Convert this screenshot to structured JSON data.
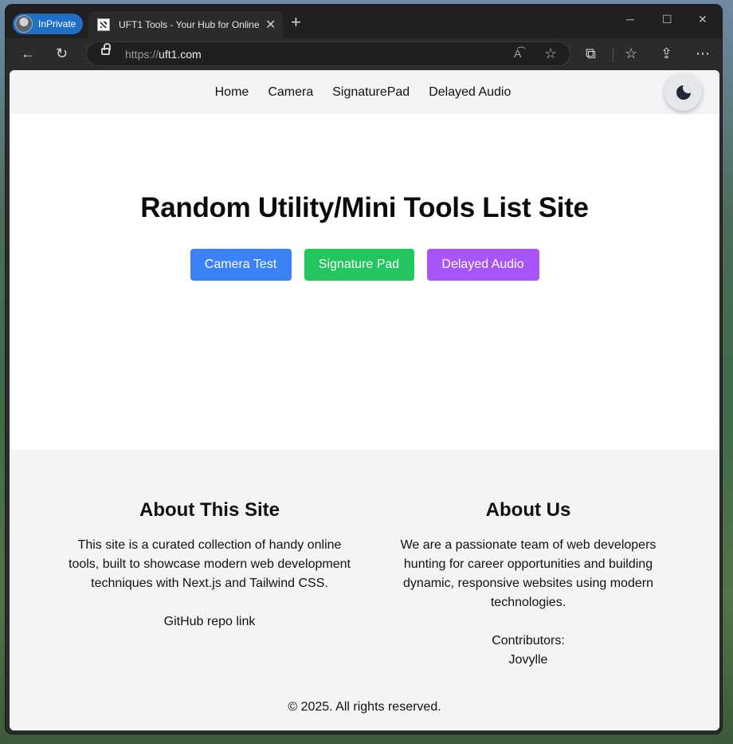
{
  "browser": {
    "inprivate_label": "InPrivate",
    "tab_title": "UFT1 Tools - Your Hub for Online",
    "url_scheme": "https://",
    "url_host": "uft1.com"
  },
  "nav": {
    "items": [
      {
        "label": "Home"
      },
      {
        "label": "Camera"
      },
      {
        "label": "SignaturePad"
      },
      {
        "label": "Delayed Audio"
      }
    ]
  },
  "hero": {
    "title": "Random Utility/Mini Tools List Site",
    "buttons": [
      {
        "label": "Camera Test",
        "color": "#3b82f6"
      },
      {
        "label": "Signature Pad",
        "color": "#22c55e"
      },
      {
        "label": "Delayed Audio",
        "color": "#a855f7"
      }
    ]
  },
  "footer": {
    "about_site": {
      "heading": "About This Site",
      "text": "This site is a curated collection of handy online tools, built to showcase modern web development techniques with Next.js and Tailwind CSS.",
      "link": "GitHub repo link"
    },
    "about_us": {
      "heading": "About Us",
      "text": "We are a passionate team of web developers hunting for career opportunities and building dynamic, responsive websites using modern technologies.",
      "contributors_label": "Contributors:",
      "contributors": "Jovylle"
    },
    "copyright": "© 2025. All rights reserved."
  }
}
